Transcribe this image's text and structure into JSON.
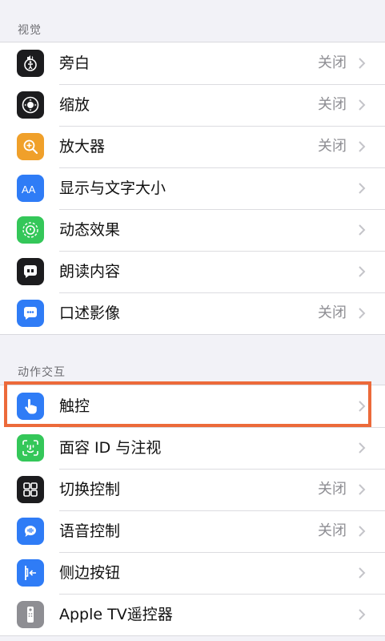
{
  "sections": [
    {
      "header": "视觉",
      "rows": [
        {
          "label": "旁白",
          "value": "关闭",
          "icon": "voiceover-icon",
          "color": "#1c1c1e"
        },
        {
          "label": "缩放",
          "value": "关闭",
          "icon": "zoom-icon",
          "color": "#1c1c1e"
        },
        {
          "label": "放大器",
          "value": "关闭",
          "icon": "magnifier-icon",
          "color": "#f0a02a"
        },
        {
          "label": "显示与文字大小",
          "value": "",
          "icon": "text-size-icon",
          "color": "#2f7cf6"
        },
        {
          "label": "动态效果",
          "value": "",
          "icon": "motion-icon",
          "color": "#34c759"
        },
        {
          "label": "朗读内容",
          "value": "",
          "icon": "speech-bubble-icon",
          "color": "#1c1c1e"
        },
        {
          "label": "口述影像",
          "value": "关闭",
          "icon": "audio-description-icon",
          "color": "#2f7cf6"
        }
      ]
    },
    {
      "header": "动作交互",
      "rows": [
        {
          "label": "触控",
          "value": "",
          "icon": "touch-hand-icon",
          "color": "#2f7cf6"
        },
        {
          "label": "面容 ID 与注视",
          "value": "",
          "icon": "face-id-icon",
          "color": "#34c759"
        },
        {
          "label": "切换控制",
          "value": "关闭",
          "icon": "switch-control-icon",
          "color": "#1c1c1e"
        },
        {
          "label": "语音控制",
          "value": "关闭",
          "icon": "voice-control-icon",
          "color": "#2f7cf6"
        },
        {
          "label": "侧边按钮",
          "value": "",
          "icon": "side-button-icon",
          "color": "#2f7cf6"
        },
        {
          "label": "Apple TV遥控器",
          "value": "",
          "icon": "tv-remote-icon",
          "color": "#8e8e93"
        }
      ]
    }
  ],
  "highlight_color": "#ec6a3a"
}
